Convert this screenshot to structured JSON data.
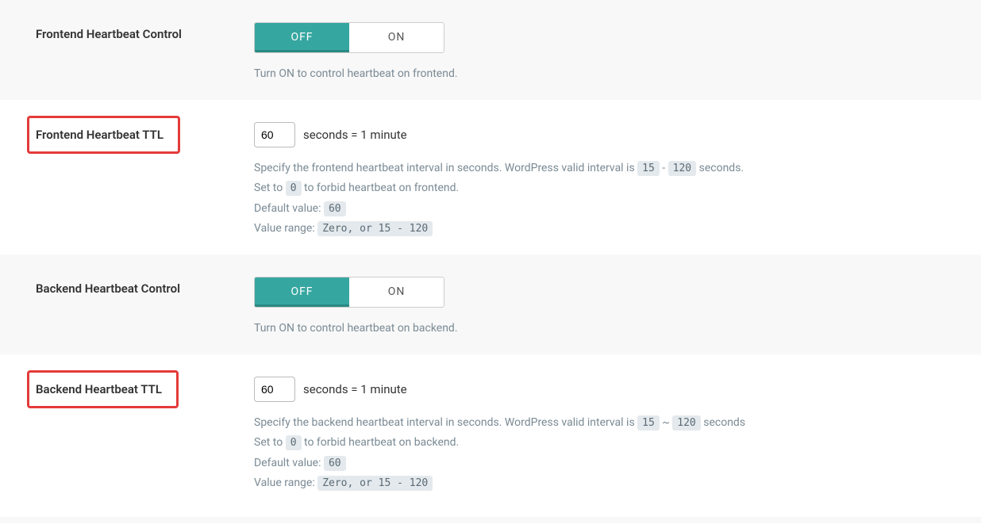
{
  "rows": [
    {
      "key": "frontend_control",
      "label": "Frontend Heartbeat Control",
      "highlight": false,
      "bg": "gray",
      "type": "toggle",
      "toggle": {
        "off": "OFF",
        "on": "ON",
        "value": "OFF"
      },
      "desc_html": "Turn ON to control heartbeat on frontend."
    },
    {
      "key": "frontend_ttl",
      "label": "Frontend Heartbeat TTL",
      "highlight": true,
      "bg": "white",
      "type": "number",
      "input": {
        "value": "60",
        "suffix": "seconds = 1 minute"
      },
      "desc_html": "Specify the frontend heartbeat interval in seconds. WordPress valid interval is <span class=\"code-chip\">15</span> - <span class=\"code-chip\">120</span> seconds.<br>Set to <span class=\"code-chip\">0</span> to forbid heartbeat on frontend.<br>Default value: <span class=\"code-chip\">60</span><br>Value range: <span class=\"code-chip\">Zero, or 15 - 120</span>"
    },
    {
      "key": "backend_control",
      "label": "Backend Heartbeat Control",
      "highlight": false,
      "bg": "gray",
      "type": "toggle",
      "toggle": {
        "off": "OFF",
        "on": "ON",
        "value": "OFF"
      },
      "desc_html": "Turn ON to control heartbeat on backend."
    },
    {
      "key": "backend_ttl",
      "label": "Backend Heartbeat TTL",
      "highlight": true,
      "bg": "white",
      "type": "number",
      "input": {
        "value": "60",
        "suffix": "seconds = 1 minute"
      },
      "desc_html": "Specify the backend heartbeat interval in seconds. WordPress valid interval is <span class=\"code-chip\">15</span> ~ <span class=\"code-chip\">120</span> seconds<br>Set to <span class=\"code-chip\">0</span> to forbid heartbeat on backend.<br>Default value: <span class=\"code-chip\">60</span><br>Value range: <span class=\"code-chip\">Zero, or 15 - 120</span>"
    }
  ]
}
